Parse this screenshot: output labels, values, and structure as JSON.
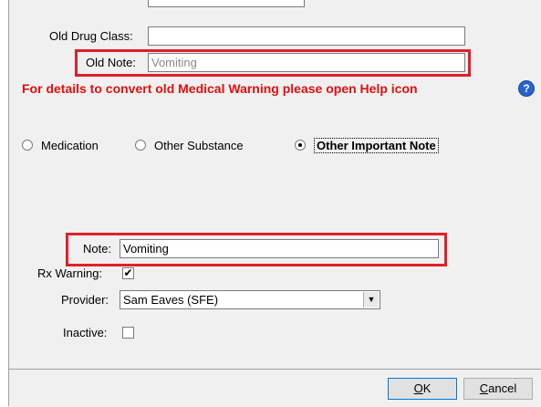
{
  "form": {
    "old_drug_class": {
      "label": "Old Drug Class:",
      "value": ""
    },
    "old_note": {
      "label": "Old Note:",
      "value": "Vomiting"
    },
    "warning_text": "For details to convert old Medical Warning please open Help icon",
    "help_icon": "help-icon",
    "type_options": [
      {
        "label": "Medication",
        "selected": false
      },
      {
        "label": "Other Substance",
        "selected": false
      },
      {
        "label": "Other Important Note",
        "selected": true
      }
    ],
    "note": {
      "label": "Note:",
      "value": "Vomiting"
    },
    "rx_warning": {
      "label": "Rx Warning:",
      "checked": true,
      "mark": "✔"
    },
    "provider": {
      "label": "Provider:",
      "value": "Sam Eaves (SFE)",
      "arrow": "▼"
    },
    "inactive": {
      "label": "Inactive:",
      "checked": false
    }
  },
  "buttons": {
    "ok_mnemonic": "O",
    "ok_rest": "K",
    "cancel_mnemonic": "C",
    "cancel_rest": "ancel"
  },
  "colors": {
    "highlight": "#e0202a",
    "warning": "#e01010",
    "help_icon_bg": "#2a62c9"
  }
}
